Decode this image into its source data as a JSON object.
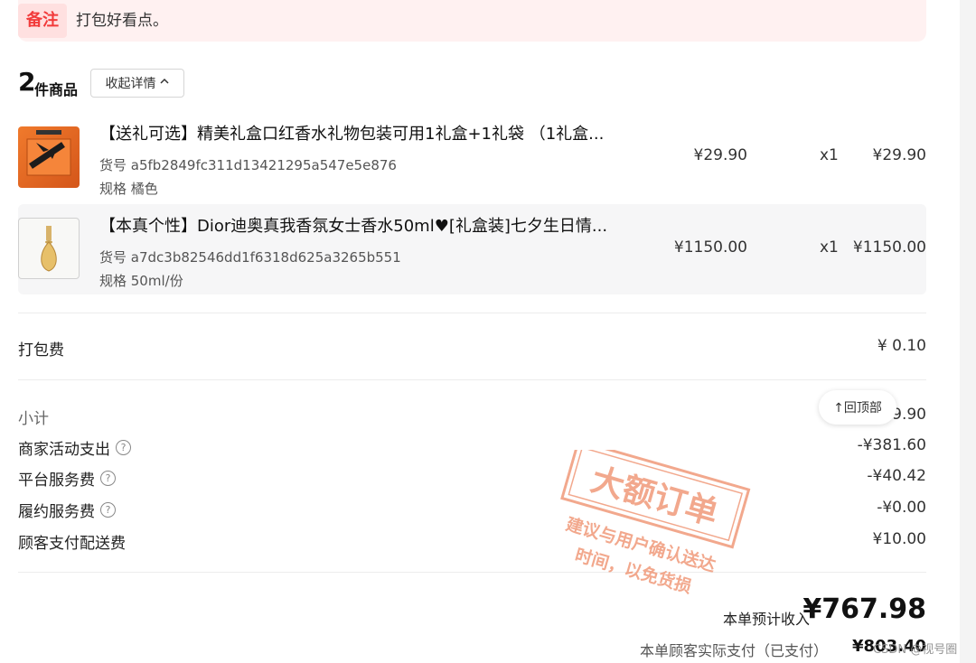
{
  "note": {
    "tag": "备注",
    "text": "打包好看点。"
  },
  "goods_header": {
    "count": "2",
    "count_label": "件商品",
    "collapse_label": "收起详情"
  },
  "items": [
    {
      "title": "【送礼可选】精美礼盒口红香水礼物包装可用1礼盒+1礼袋 （1礼盒...",
      "sku": "货号 a5fb2849fc311d13421295a547e5e876",
      "spec": "规格 橘色",
      "price": "¥29.90",
      "qty": "x1",
      "total": "¥29.90"
    },
    {
      "title": "【本真个性】Dior迪奥真我香氛女士香水50ml♥[礼盒装]七夕生日情...",
      "sku": "货号 a7dc3b82546dd1f6318d625a3265b551",
      "spec": "规格 50ml/份",
      "price": "¥1150.00",
      "qty": "x1",
      "total": "¥1150.00"
    }
  ],
  "packing_fee": {
    "label": "打包费",
    "value": "¥ 0.10"
  },
  "summary": {
    "subtotal": {
      "label": "小计",
      "value": "9.90"
    },
    "merchant_activity": {
      "label": "商家活动支出",
      "value": "-¥381.60"
    },
    "platform_fee": {
      "label": "平台服务费",
      "value": "-¥40.42"
    },
    "fulfillment_fee": {
      "label": "履约服务费",
      "value": "-¥0.00"
    },
    "delivery_fee": {
      "label": "顾客支付配送费",
      "value": "¥10.00"
    }
  },
  "back_to_top": "↑回顶部",
  "stamp": {
    "title": "大额订单",
    "line1": "建议与用户确认送达",
    "line2": "时间，以免货损"
  },
  "income": {
    "label": "本单预计收入",
    "value": "¥767.98"
  },
  "paid": {
    "label": "本单顾客实际支付（已支付）",
    "value": "¥803.40"
  },
  "watermark": "CSDN @视号圈",
  "colors": {
    "accent": "#f23b3b",
    "stamp": "#f09a7a"
  }
}
